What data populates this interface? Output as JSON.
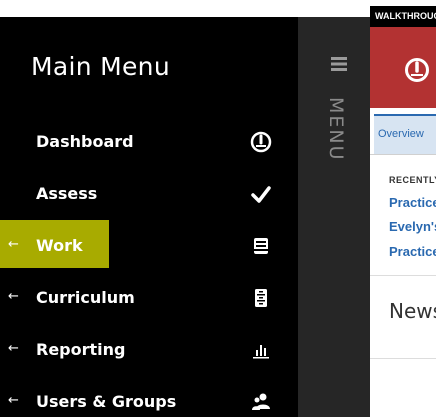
{
  "menu": {
    "title": "Main Menu",
    "items": [
      {
        "label": "Dashboard",
        "arrow": "",
        "icon": "dashboard-gauge-icon"
      },
      {
        "label": "Assess",
        "arrow": "",
        "icon": "checkmark-icon"
      },
      {
        "label": "Work",
        "arrow": "←",
        "icon": "work-tray-icon"
      },
      {
        "label": "Curriculum",
        "arrow": "←",
        "icon": "curriculum-cabinet-icon"
      },
      {
        "label": "Reporting",
        "arrow": "←",
        "icon": "bar-chart-icon"
      },
      {
        "label": "Users & Groups",
        "arrow": "←",
        "icon": "users-icon"
      }
    ],
    "highlight_color": "#e0e400"
  },
  "strip": {
    "label": "MENU",
    "icon": "hamburger-icon"
  },
  "walkthrough": {
    "label": "WALKTHROUGH"
  },
  "header": {
    "color": "#b33232",
    "logo_icon": "gauge-logo-icon"
  },
  "tabs": [
    {
      "label": "Overview",
      "selected": true
    }
  ],
  "recent": {
    "heading": "RECENTLY",
    "links": [
      "Practice",
      "Evelyn's",
      "Practice"
    ]
  },
  "news": {
    "title": "News"
  },
  "colors": {
    "accent": "#2a69b0",
    "menu_bg": "#000000",
    "strip_bg": "#262626"
  }
}
